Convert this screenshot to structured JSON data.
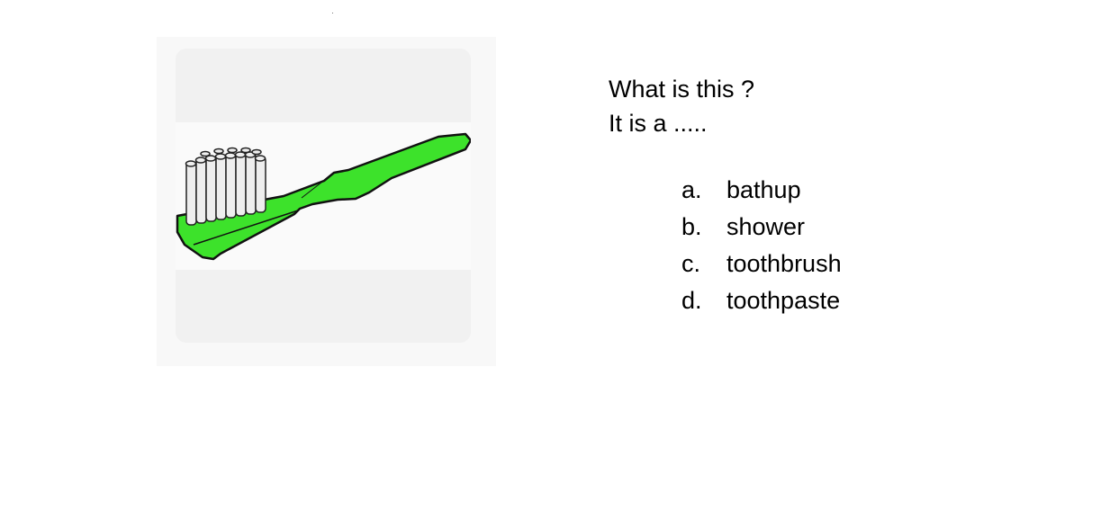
{
  "picture": {
    "icon": "toothbrush-icon",
    "handle_color": "#3de22b",
    "bristle_color": "#eeeeee"
  },
  "question": {
    "line1": "What is this ?",
    "line2": "It is a ....."
  },
  "options": [
    {
      "letter": "a.",
      "text": "bathup"
    },
    {
      "letter": "b.",
      "text": "shower"
    },
    {
      "letter": "c.",
      "text": "toothbrush"
    },
    {
      "letter": "d.",
      "text": "toothpaste"
    }
  ]
}
